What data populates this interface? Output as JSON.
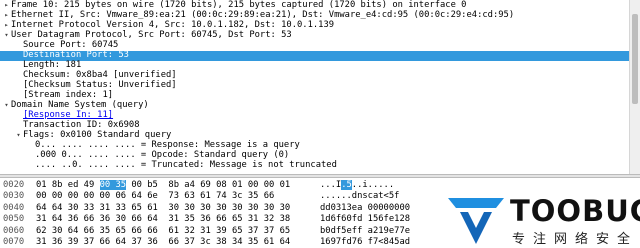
{
  "details_tree": [
    {
      "indent": 0,
      "expander": "collapsed",
      "text": "Frame 10: 215 bytes on wire (1720 bits), 215 bytes captured (1720 bits) on interface 0"
    },
    {
      "indent": 0,
      "expander": "collapsed",
      "text": "Ethernet II, Src: Vmware_89:ea:21 (00:0c:29:89:ea:21), Dst: Vmware_e4:cd:95 (00:0c:29:e4:cd:95)"
    },
    {
      "indent": 0,
      "expander": "collapsed",
      "text": "Internet Protocol Version 4, Src: 10.0.1.182, Dst: 10.0.1.139"
    },
    {
      "indent": 0,
      "expander": "expanded",
      "text": "User Datagram Protocol, Src Port: 60745, Dst Port: 53"
    },
    {
      "indent": 1,
      "expander": "none",
      "text": "Source Port: 60745"
    },
    {
      "indent": 1,
      "expander": "none",
      "text": "Destination Port: 53",
      "selected": true
    },
    {
      "indent": 1,
      "expander": "none",
      "text": "Length: 181"
    },
    {
      "indent": 1,
      "expander": "none",
      "text": "Checksum: 0x8ba4 [unverified]"
    },
    {
      "indent": 1,
      "expander": "none",
      "text": "[Checksum Status: Unverified]"
    },
    {
      "indent": 1,
      "expander": "none",
      "text": "[Stream index: 1]"
    },
    {
      "indent": 0,
      "expander": "expanded",
      "text": "Domain Name System (query)"
    },
    {
      "indent": 1,
      "expander": "none",
      "text": "[Response In: 11]",
      "link": true
    },
    {
      "indent": 1,
      "expander": "none",
      "text": "Transaction ID: 0x6908"
    },
    {
      "indent": 1,
      "expander": "expanded",
      "text": "Flags: 0x0100 Standard query"
    },
    {
      "indent": 2,
      "expander": "none",
      "text": "0... .... .... .... = Response: Message is a query"
    },
    {
      "indent": 2,
      "expander": "none",
      "text": ".000 0... .... .... = Opcode: Standard query (0)"
    },
    {
      "indent": 2,
      "expander": "none",
      "text": ".... ..0. .... .... = Truncated: Message is not truncated"
    }
  ],
  "bytes_pane": {
    "rows": [
      {
        "offset": "0020",
        "bytes_pre": "01 8b ed 49 ",
        "bytes_hl": "00 35",
        "bytes_post": " 00 b5  8b a4 69 08 01 00 00 01",
        "ascii_pre": "...I",
        "ascii_hl": ".5",
        "ascii_post": "..i....."
      },
      {
        "offset": "0030",
        "bytes_pre": "00 00 00 00 00 06 64 6e  73 63 61 74 3c 35 66",
        "bytes_hl": "",
        "bytes_post": "",
        "ascii_pre": "......dnscat<5f",
        "ascii_hl": "",
        "ascii_post": ""
      },
      {
        "offset": "0040",
        "bytes_pre": "64 64 30 33 31 33 65 61  30 30 30 30 30 30 30 30",
        "bytes_hl": "",
        "bytes_post": "",
        "ascii_pre": "dd0313ea 00000000",
        "ascii_hl": "",
        "ascii_post": ""
      },
      {
        "offset": "0050",
        "bytes_pre": "31 64 36 66 36 30 66 64  31 35 36 66 65 31 32 38",
        "bytes_hl": "",
        "bytes_post": "",
        "ascii_pre": "1d6f60fd 156fe128",
        "ascii_hl": "",
        "ascii_post": ""
      },
      {
        "offset": "0060",
        "bytes_pre": "62 30 64 66 35 65 66 66  61 32 31 39 65 37 37 65",
        "bytes_hl": "",
        "bytes_post": "",
        "ascii_pre": "b0df5eff a219e77e",
        "ascii_hl": "",
        "ascii_post": ""
      },
      {
        "offset": "0070",
        "bytes_pre": "31 36 39 37 66 64 37 36  66 37 3c 38 34 35 61 64",
        "bytes_hl": "",
        "bytes_post": "",
        "ascii_pre": "1697fd76 f7<845ad",
        "ascii_hl": "",
        "ascii_post": ""
      }
    ]
  },
  "watermark": {
    "brand": "TOOBUG",
    "tagline": "专注网络安全",
    "colors": {
      "blue": "#1f8fe0",
      "dark_blue": "#1466b8"
    }
  },
  "colors": {
    "selection": "#3399dd",
    "link": "#0000ee"
  }
}
